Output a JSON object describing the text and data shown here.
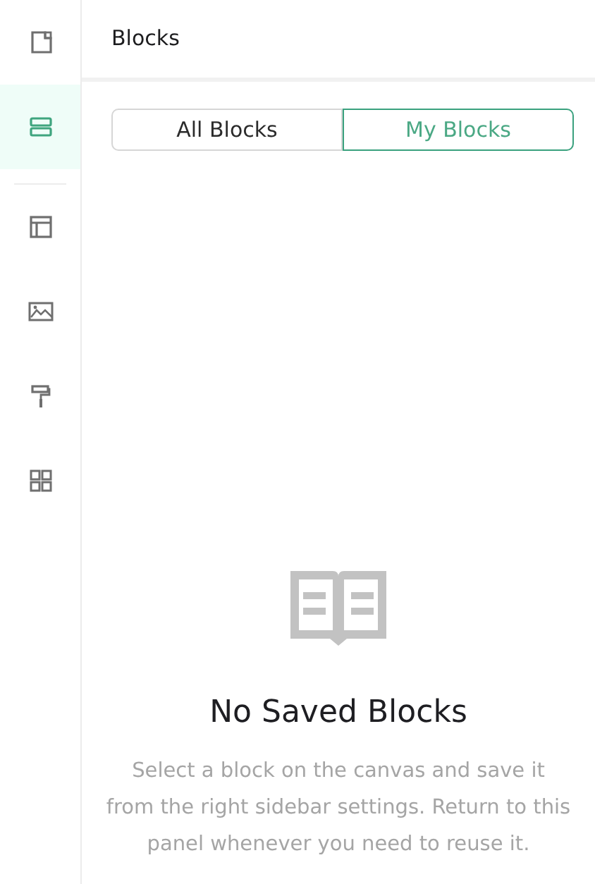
{
  "sidebar": {
    "groups": [
      {
        "items": [
          {
            "selected": false
          },
          {
            "selected": true
          }
        ]
      },
      {
        "items": [
          {
            "selected": false
          },
          {
            "selected": false
          },
          {
            "selected": false
          },
          {
            "selected": false
          }
        ]
      }
    ]
  },
  "panel": {
    "title": "Blocks",
    "tabs": [
      {
        "label": "All Blocks",
        "selected": false
      },
      {
        "label": "My Blocks",
        "selected": true
      }
    ],
    "empty_state": {
      "title": "No Saved Blocks",
      "description": "Select a block on the canvas and save it from the right sidebar settings. Return to this panel whenever you need to reuse it."
    }
  }
}
